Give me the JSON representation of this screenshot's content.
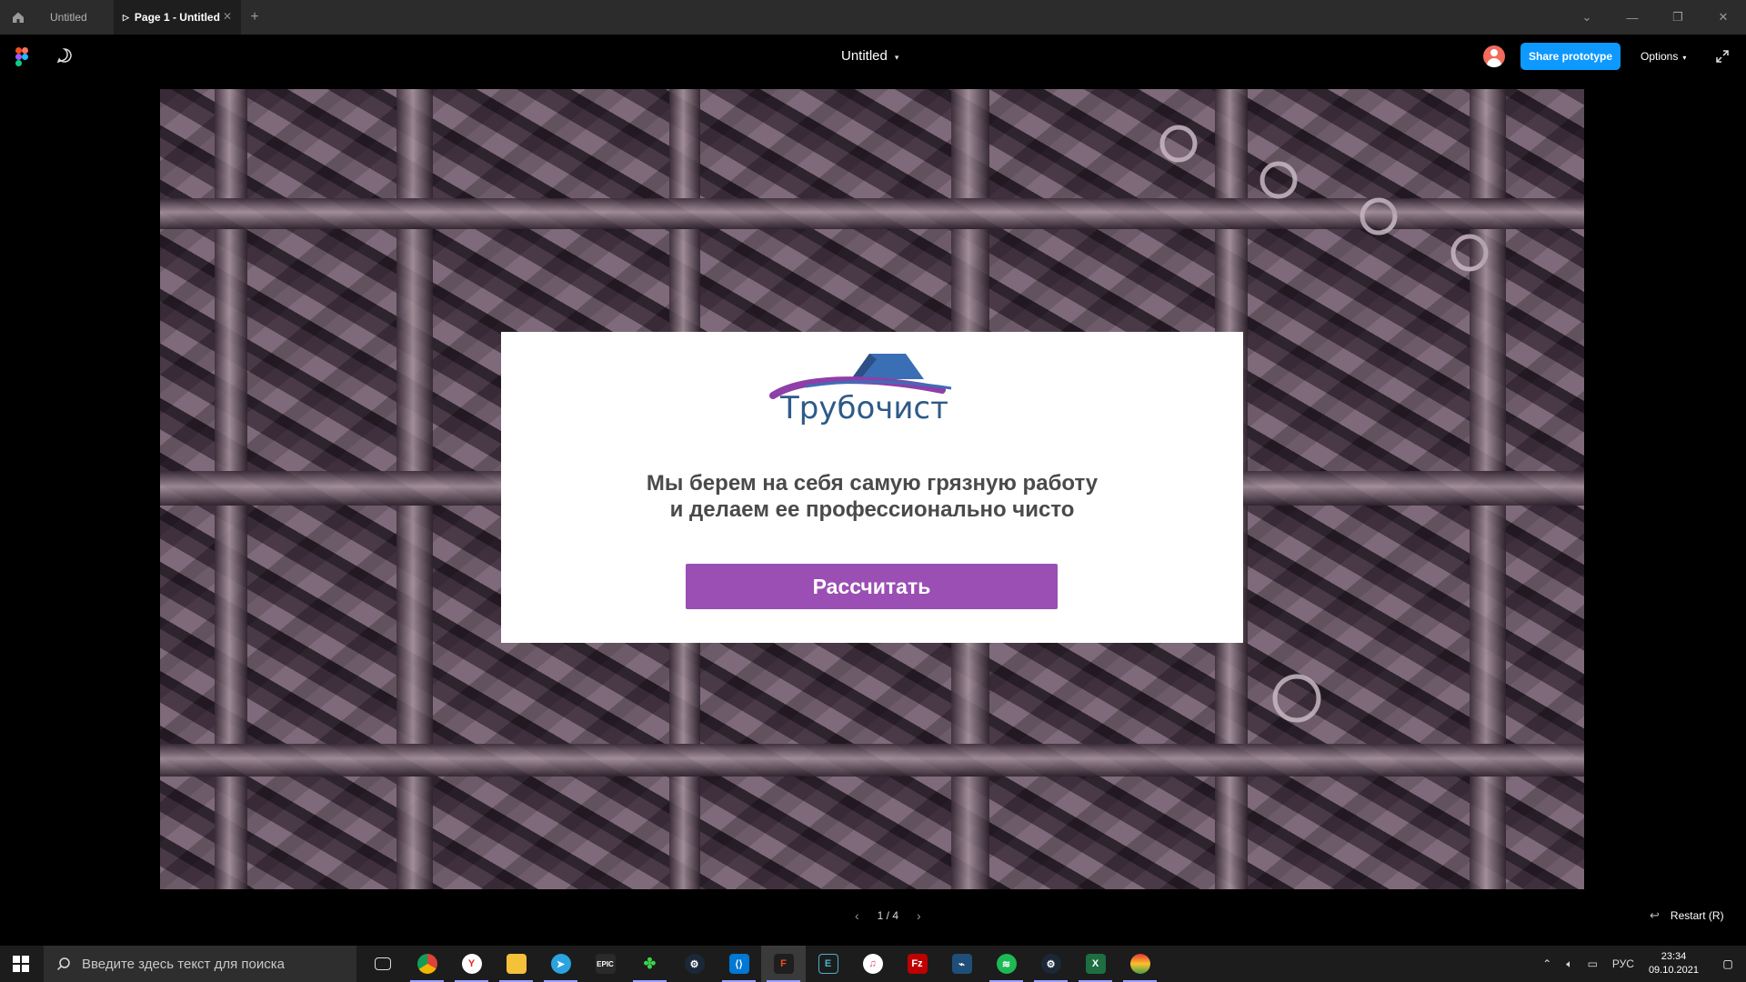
{
  "tabs": [
    {
      "label": "Untitled"
    },
    {
      "label": "Page 1 - Untitled"
    }
  ],
  "toolbar": {
    "doc_title": "Untitled",
    "share_label": "Share prototype",
    "options_label": "Options"
  },
  "card": {
    "logo_text": "Трубочист",
    "headline_line1": "Мы берем на себя самую грязную работу",
    "headline_line2": "и делаем ее профессионально чисто",
    "button_label": "Рассчитать"
  },
  "player": {
    "page_indicator": "1 / 4",
    "restart_label": "Restart (R)"
  },
  "taskbar": {
    "search_placeholder": "Введите здесь текст для поиска",
    "apps": [
      "task-view",
      "chrome",
      "yandex-browser",
      "file-explorer",
      "telegram",
      "epic-games",
      "cheat-engine",
      "steam",
      "vscode",
      "figma",
      "terminal",
      "itunes",
      "filezilla",
      "unknown-app",
      "spotify",
      "steam-2",
      "excel",
      "colorful-app"
    ],
    "language": "РУС",
    "time": "23:34",
    "date": "09.10.2021"
  },
  "colors": {
    "share_button": "#0d99ff",
    "cta_button": "#9b4eb3",
    "logo_blue": "#2e5a87",
    "logo_purple": "#8e3fa8"
  }
}
